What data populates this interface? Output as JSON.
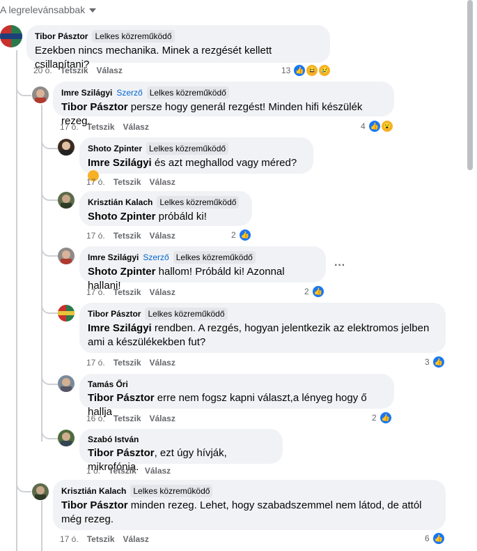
{
  "sort_label": "A legrelevánsabbak",
  "comments": [
    {
      "author": "Tibor Pásztor",
      "role": "",
      "badge": "Lelkes közreműködő",
      "mention": "",
      "text": "Ezekben nincs mechanika. Minek a rezgését kellett csillapítani?",
      "time": "20 ó.",
      "like": "Tetszik",
      "reply": "Válasz",
      "reactions": "13"
    },
    {
      "author": "Imre Szilágyi",
      "role": "Szerző",
      "badge": "Lelkes közreműködő",
      "mention": "Tibor Pásztor",
      "text": " persze hogy generál rezgést! Minden hifi készülék rezeg.",
      "time": "17 ó.",
      "like": "Tetszik",
      "reply": "Válasz",
      "reactions": "4"
    },
    {
      "author": "Shoto Zpinter",
      "role": "",
      "badge": "Lelkes közreműködő",
      "mention": "Imre Szilágyi",
      "text": " és azt meghallod vagy méred? ",
      "time": "17 ó.",
      "like": "Tetszik",
      "reply": "Válasz",
      "reactions": ""
    },
    {
      "author": "Krisztián Kalach",
      "role": "",
      "badge": "Lelkes közreműködő",
      "mention": "Shoto Zpinter",
      "text": " próbáld ki!",
      "time": "17 ó.",
      "like": "Tetszik",
      "reply": "Válasz",
      "reactions": "2"
    },
    {
      "author": "Imre Szilágyi",
      "role": "Szerző",
      "badge": "Lelkes közreműködő",
      "mention": "Shoto Zpinter",
      "text": " hallom! Próbáld ki! Azonnal hallani!",
      "time": "17 ó.",
      "like": "Tetszik",
      "reply": "Válasz",
      "reactions": "2",
      "more": "···"
    },
    {
      "author": "Tibor Pásztor",
      "role": "",
      "badge": "Lelkes közreműködő",
      "mention": "Imre Szilágyi",
      "text": " rendben. A rezgés, hogyan jelentkezik az elektromos jelben ami a készülékekben fut?",
      "time": "17 ó.",
      "like": "Tetszik",
      "reply": "Válasz",
      "reactions": "3"
    },
    {
      "author": "Tamás Őri",
      "role": "",
      "badge": "",
      "mention": "Tibor Pásztor",
      "text": " erre nem fogsz kapni választ,a lényeg hogy ő hallja",
      "time": "16 ó.",
      "like": "Tetszik",
      "reply": "Válasz",
      "reactions": "2"
    },
    {
      "author": "Szabó István",
      "role": "",
      "badge": "",
      "mention": "Tibor Pásztor",
      "text": ", ezt úgy hívják, mikrofónia.",
      "time": "1 ó.",
      "like": "Tetszik",
      "reply": "Válasz",
      "reactions": ""
    },
    {
      "author": "Krisztián Kalach",
      "role": "",
      "badge": "Lelkes közreműködő",
      "mention": "Tibor Pásztor",
      "text": " minden rezeg. Lehet, hogy szabadszemmel nem látod, de attól még rezeg.",
      "time": "17 ó.",
      "like": "Tetszik",
      "reply": "Válasz",
      "reactions": "6"
    }
  ]
}
